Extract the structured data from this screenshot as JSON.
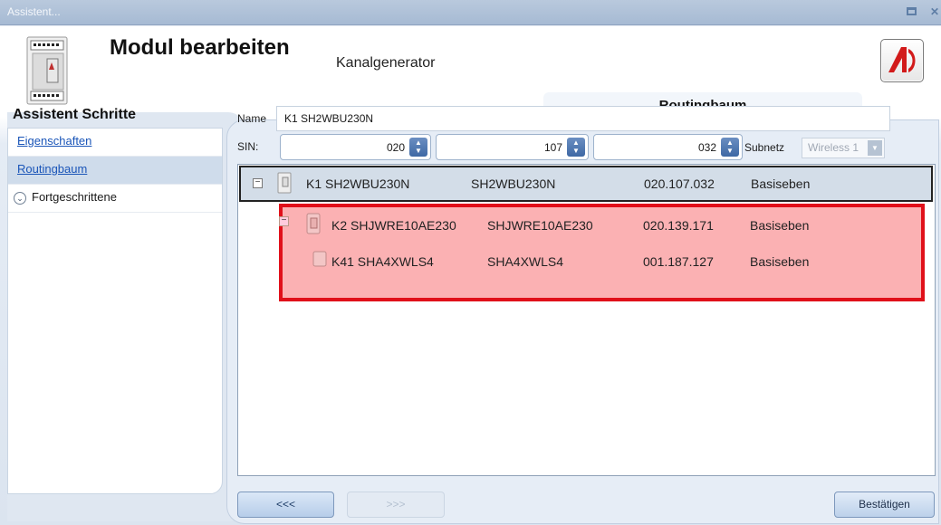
{
  "window": {
    "title": "Assistent..."
  },
  "header": {
    "title": "Modul bearbeiten",
    "subtitle": "Kanalgenerator",
    "active_tab": "Routingbaum"
  },
  "sidebar": {
    "title": "Assistent Schritte",
    "items": [
      {
        "label": "Eigenschaften"
      },
      {
        "label": "Routingbaum"
      },
      {
        "label": "Fortgeschrittene"
      }
    ]
  },
  "form": {
    "name_label": "Name",
    "name_value": "K1 SH2WBU230N",
    "sin_label": "SIN:",
    "sin_values": [
      "020",
      "107",
      "032"
    ],
    "subnet_label": "Subnetz",
    "subnet_value": "Wireless 1"
  },
  "tree": {
    "rows": [
      {
        "name": "K1 SH2WBU230N",
        "type": "SH2WBU230N",
        "address": "020.107.032",
        "level": "Basiseben"
      },
      {
        "name": "K2 SHJWRE10AE230",
        "type": "SHJWRE10AE230",
        "address": "020.139.171",
        "level": "Basiseben"
      },
      {
        "name": "K41 SHA4XWLS4",
        "type": "SHA4XWLS4",
        "address": "001.187.127",
        "level": "Basiseben"
      }
    ]
  },
  "footer": {
    "back_label": "<<<",
    "next_label": ">>>",
    "confirm_label": "Bestätigen"
  },
  "colors": {
    "highlight_border": "#e0101a",
    "highlight_fill": "#fbb1b3",
    "accent": "#3e68a4"
  }
}
